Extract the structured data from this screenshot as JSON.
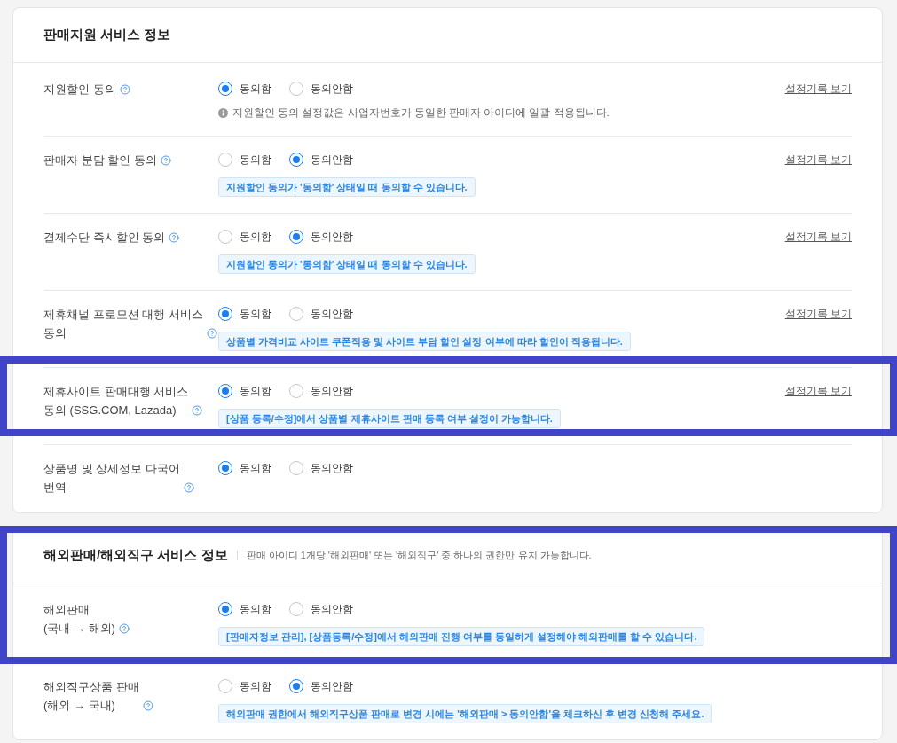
{
  "sections": [
    {
      "title": "판매지원 서비스 정보",
      "header_highlighted": false,
      "rows": [
        {
          "label": "지원할인 동의",
          "options": [
            {
              "label": "동의함",
              "selected": true
            },
            {
              "label": "동의안함",
              "selected": false
            }
          ],
          "note": {
            "kind": "info",
            "text": "지원할인 동의 설정값은 사업자번호가 동일한 판매자 아이디에 일괄 적용됩니다."
          },
          "history_link": "설정기록 보기",
          "highlighted": false
        },
        {
          "label": "판매자 분담 할인 동의",
          "options": [
            {
              "label": "동의함",
              "selected": false
            },
            {
              "label": "동의안함",
              "selected": true
            }
          ],
          "note": {
            "kind": "tip",
            "text": "지원할인 동의가 '동의함' 상태일 때 동의할 수 있습니다."
          },
          "history_link": "설정기록 보기",
          "highlighted": false
        },
        {
          "label": "결제수단 즉시할인 동의",
          "options": [
            {
              "label": "동의함",
              "selected": false
            },
            {
              "label": "동의안함",
              "selected": true
            }
          ],
          "note": {
            "kind": "tip",
            "text": "지원할인 동의가 '동의함' 상태일 때 동의할 수 있습니다."
          },
          "history_link": "설정기록 보기",
          "highlighted": false
        },
        {
          "label": "제휴채널 프로모션 대행 서비스\n동의",
          "options": [
            {
              "label": "동의함",
              "selected": true
            },
            {
              "label": "동의안함",
              "selected": false
            }
          ],
          "note": {
            "kind": "tip",
            "text": "상품별 가격비교 사이트 쿠폰적용 및 사이트 부담 할인 설정 여부에 따라 할인이 적용됩니다."
          },
          "history_link": "설정기록 보기",
          "highlighted": false
        },
        {
          "label": "제휴사이트 판매대행 서비스\n동의 (SSG.COM, Lazada)",
          "options": [
            {
              "label": "동의함",
              "selected": true
            },
            {
              "label": "동의안함",
              "selected": false
            }
          ],
          "note": {
            "kind": "tip",
            "text": "[상품 등록/수정]에서 상품별 제휴사이트 판매 등록 여부 설정이 가능합니다."
          },
          "history_link": "설정기록 보기",
          "highlighted": true
        },
        {
          "label": "상품명 및 상세정보 다국어\n번역",
          "options": [
            {
              "label": "동의함",
              "selected": true
            },
            {
              "label": "동의안함",
              "selected": false
            }
          ],
          "highlighted": false
        }
      ]
    },
    {
      "title": "해외판매/해외직구 서비스 정보",
      "subtitle": "판매 아이디 1개당 '해외판매' 또는 '해외직구' 중 하나의 권한만 유지 가능합니다.",
      "header_highlighted": true,
      "rows": [
        {
          "label": "해외판매\n(국내 → 해외)",
          "options": [
            {
              "label": "동의함",
              "selected": true
            },
            {
              "label": "동의안함",
              "selected": false
            }
          ],
          "note": {
            "kind": "tip",
            "text": "[판매자정보 관리], [상품등록/수정]에서 해외판매 진행 여부를 동일하게 설정해야 해외판매를 할 수 있습니다."
          },
          "highlighted": true
        },
        {
          "label": "해외직구상품 판매\n(해외 → 국내)",
          "options": [
            {
              "label": "동의함",
              "selected": false
            },
            {
              "label": "동의안함",
              "selected": true
            }
          ],
          "note": {
            "kind": "tip",
            "text": "해외판매 권한에서 해외직구상품 판매로 변경 시에는 '해외판매 > 동의안함'을 체크하신 후 변경 신청해 주세요."
          },
          "highlighted": false
        }
      ]
    }
  ]
}
